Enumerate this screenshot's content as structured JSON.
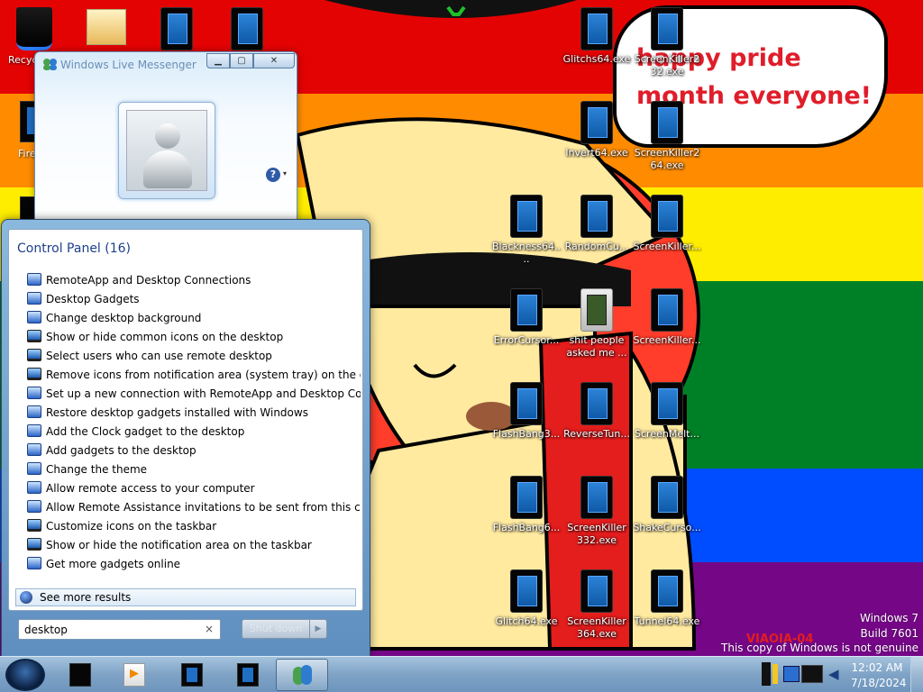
{
  "wallpaper": {
    "bubble_text": "happy pride month everyone!",
    "flag_colors": [
      "#e40303",
      "#ff8c00",
      "#ffed00",
      "#008026",
      "#004dff",
      "#750787"
    ],
    "graffiti_text": "VIAOIA-04"
  },
  "left_icons": {
    "recycle_label": "Recyc",
    "firefox_label": "Fire"
  },
  "desktop_icons": [
    {
      "label": "Glitchs64.exe",
      "icon": "app-icon"
    },
    {
      "label": "ScreenKiller232.exe",
      "icon": "app-icon"
    },
    {
      "label": "Invert64.exe",
      "icon": "app-icon"
    },
    {
      "label": "ScreenKiller264.exe",
      "icon": "app-icon"
    },
    {
      "label": "Blackness64....",
      "icon": "app-icon"
    },
    {
      "label": "RandomCu...",
      "icon": "app-icon"
    },
    {
      "label": "ScreenKiller...",
      "icon": "app-icon"
    },
    {
      "label": "ErrorCursor...",
      "icon": "app-icon"
    },
    {
      "label": "shit people asked me ...",
      "icon": "folder-icon"
    },
    {
      "label": "ScreenKiller...",
      "icon": "app-icon"
    },
    {
      "label": "FlashBang3...",
      "icon": "app-icon"
    },
    {
      "label": "ReverseTun...",
      "icon": "app-icon"
    },
    {
      "label": "ScreenMelt...",
      "icon": "app-icon"
    },
    {
      "label": "FlashBang6...",
      "icon": "app-icon"
    },
    {
      "label": "ScreenKiller 332.exe",
      "icon": "app-icon"
    },
    {
      "label": "ShakeCurso...",
      "icon": "app-icon"
    },
    {
      "label": "Glitch64.exe",
      "icon": "app-icon"
    },
    {
      "label": "ScreenKiller 364.exe",
      "icon": "app-icon"
    },
    {
      "label": "Tunnel64.exe",
      "icon": "app-icon"
    }
  ],
  "messenger": {
    "title": "Windows Live Messenger",
    "minimize": "▁",
    "maximize": "▢",
    "close": "✕",
    "help": "?",
    "help_arrow": "▾"
  },
  "start_menu": {
    "heading": "Control Panel (16)",
    "items": [
      "RemoteApp and Desktop Connections",
      "Desktop Gadgets",
      "Change desktop background",
      "Show or hide common icons on the desktop",
      "Select users who can use remote desktop",
      "Remove icons from notification area (system tray) on the deskt...",
      "Set up a new connection with RemoteApp and Desktop Conne...",
      "Restore desktop gadgets installed with Windows",
      "Add the Clock gadget to the desktop",
      "Add gadgets to the desktop",
      "Change the theme",
      "Allow remote access to your computer",
      "Allow Remote Assistance invitations to be sent from this comp...",
      "Customize icons on the taskbar",
      "Show or hide the notification area on the taskbar",
      "Get more gadgets online"
    ],
    "see_more": "See more results",
    "search_value": "desktop",
    "search_clear": "×",
    "shutdown_label": "Shut down",
    "shutdown_arrow": "▶"
  },
  "taskbar": {
    "clock_time": "12:02 AM",
    "clock_date": "7/18/2024"
  },
  "watermark": {
    "line1": "Windows 7",
    "line2": "Build 7601",
    "line3": "This copy of Windows is not genuine"
  }
}
